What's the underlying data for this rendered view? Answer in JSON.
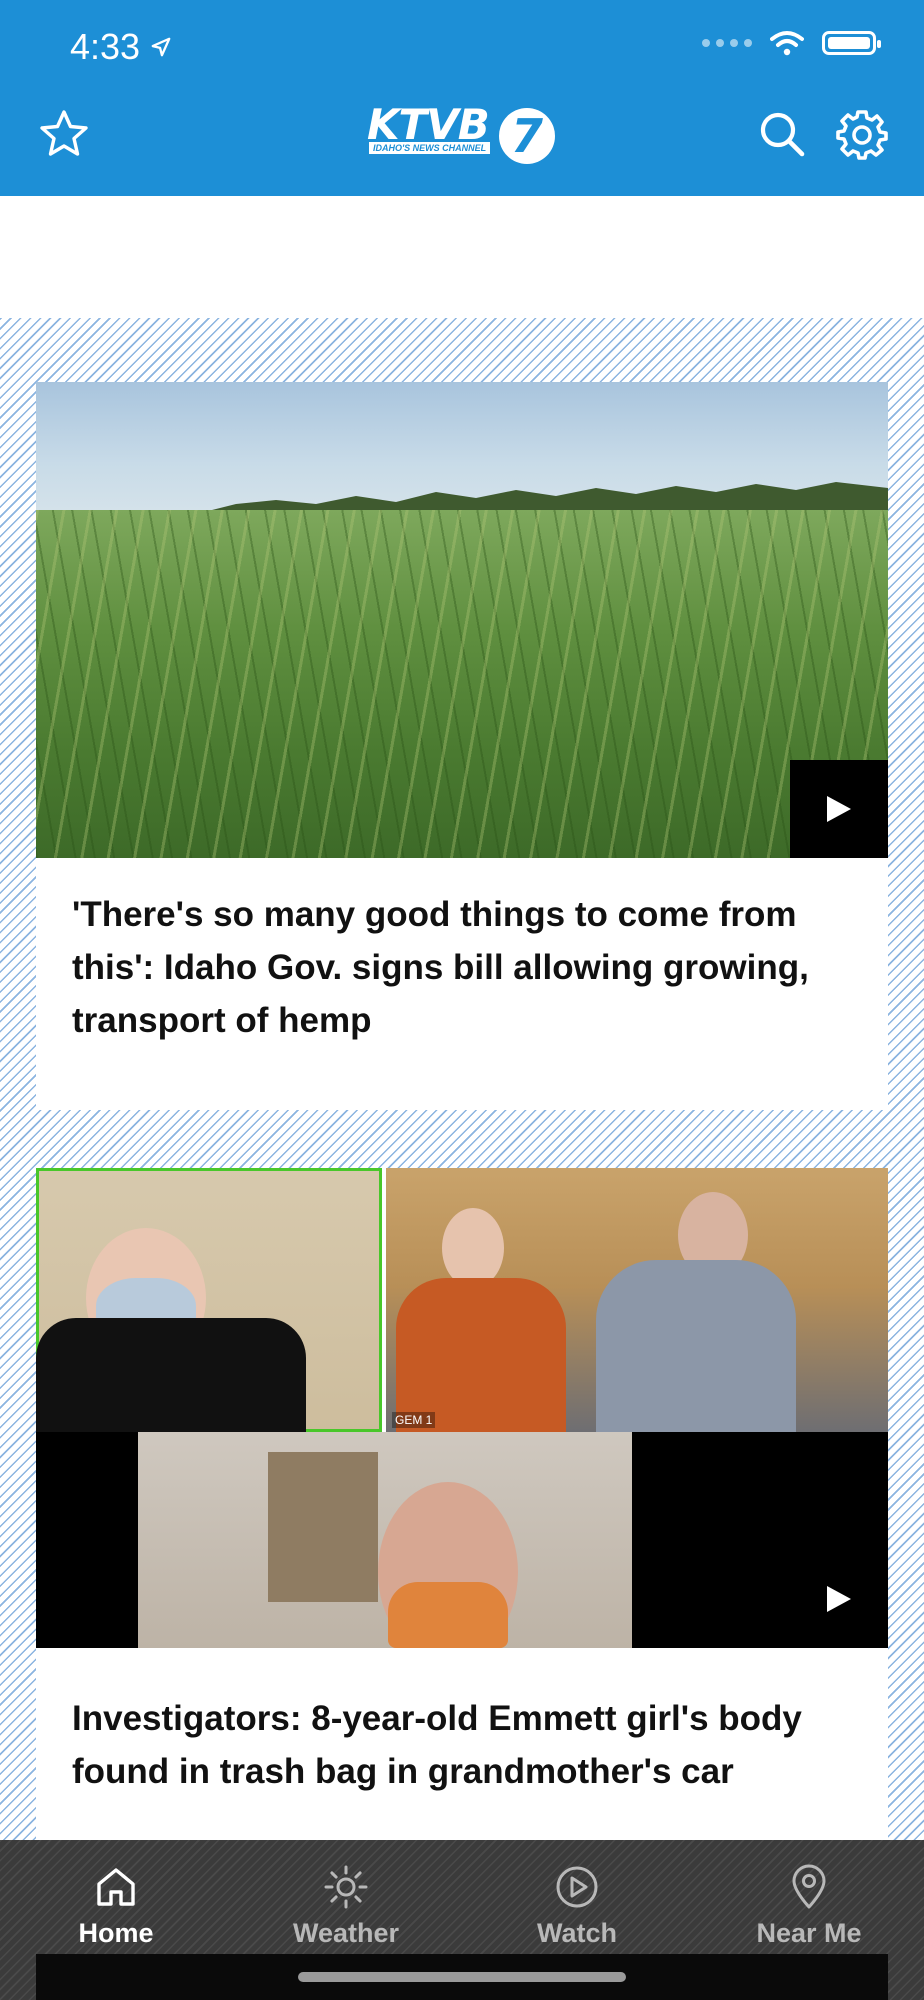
{
  "status_bar": {
    "time": "4:33"
  },
  "header": {
    "logo_text": "KTVB",
    "logo_number": "7",
    "logo_tagline": "IDAHO'S NEWS CHANNEL"
  },
  "stories": [
    {
      "headline": "'There's so many good things to come from this': Idaho Gov. signs bill allowing growing, transport of hemp"
    },
    {
      "headline": "Investigators: 8-year-old Emmett girl's body found in trash bag in grandmother's car",
      "video_label": "GEM 1"
    }
  ],
  "tabbar": {
    "tabs": [
      {
        "label": "Home",
        "icon": "home-icon",
        "active": true
      },
      {
        "label": "Weather",
        "icon": "sun-icon",
        "active": false
      },
      {
        "label": "Watch",
        "icon": "play-circle-icon",
        "active": false
      },
      {
        "label": "Near Me",
        "icon": "location-pin-icon",
        "active": false
      }
    ]
  },
  "colors": {
    "brand_blue": "#1d8fd6",
    "tabbar_bg": "#3b3b3b",
    "text_dark": "#111111"
  }
}
